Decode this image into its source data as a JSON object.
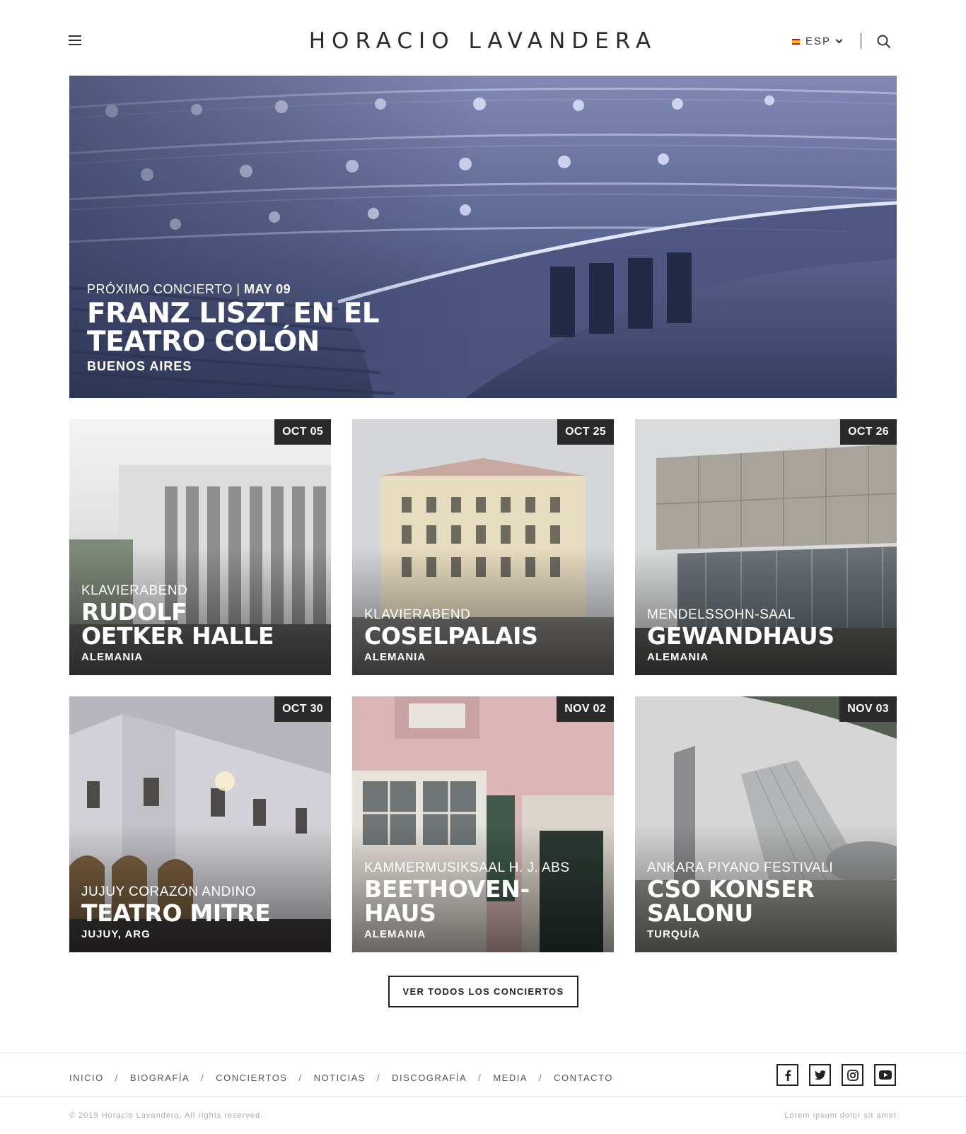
{
  "header": {
    "logo": "HORACIO LAVANDERA",
    "language": "ESP"
  },
  "hero": {
    "kicker": "PRÓXIMO CONCIERTO",
    "date": "MAY 09",
    "title_line1": "FRANZ LISZT EN EL",
    "title_line2": "TEATRO COLÓN",
    "city": "BUENOS AIRES"
  },
  "concerts": [
    {
      "date": "OCT 05",
      "kicker": "KLAVIERABEND",
      "title_line1": "RUDOLF",
      "title_line2": "OETKER HALLE",
      "location": "ALEMANIA"
    },
    {
      "date": "OCT 25",
      "kicker": "KLAVIERABEND",
      "title_line1": "COSELPALAIS",
      "title_line2": "",
      "location": "ALEMANIA"
    },
    {
      "date": "OCT 26",
      "kicker": "MENDELSSOHN-SAAL",
      "title_line1": "GEWANDHAUS",
      "title_line2": "",
      "location": "ALEMANIA"
    },
    {
      "date": "OCT 30",
      "kicker": "JUJUY CORAZÓN ANDINO",
      "title_line1": "TEATRO MITRE",
      "title_line2": "",
      "location": "JUJUY, ARG"
    },
    {
      "date": "NOV 02",
      "kicker": "KAMMERMUSIKSAAL H. J. ABS",
      "title_line1": "BEETHOVEN-",
      "title_line2": "HAUS",
      "location": "ALEMANIA"
    },
    {
      "date": "NOV 03",
      "kicker": "ANKARA PIYANO FESTIVALI",
      "title_line1": "CSO KONSER",
      "title_line2": "SALONU",
      "location": "TURQUÍA"
    }
  ],
  "cta": {
    "label": "VER TODOS LOS CONCIERTOS"
  },
  "footer": {
    "nav": [
      "INICIO",
      "BIOGRAFÍA",
      "CONCIERTOS",
      "NOTICIAS",
      "DISCOGRAFÍA",
      "MEDIA",
      "CONTACTO"
    ],
    "social": [
      "facebook-icon",
      "twitter-icon",
      "instagram-icon",
      "youtube-icon"
    ],
    "copyright": "© 2019 Horacio Lavandera. All rights reserved.",
    "tagline": "Lorem ipsum dolor sit amet"
  },
  "colors": {
    "hero_tint": "#5a6590",
    "date_badge": "#2a2a2a",
    "text_dark": "#222222"
  }
}
